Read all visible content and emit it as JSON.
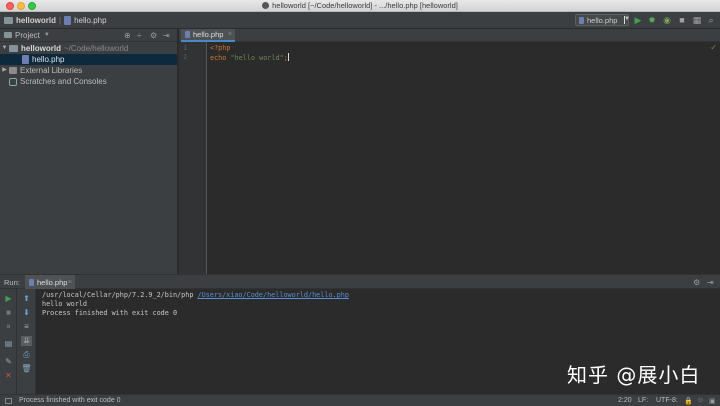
{
  "window": {
    "title": "helloworld [~/Code/helloworld] - .../hello.php [helloworld]"
  },
  "navbar": {
    "crumb_project": "helloworld",
    "crumb_file": "hello.php",
    "run_config": "hello.php"
  },
  "project": {
    "header_label": "Project",
    "tree": {
      "root_name": "helloworld",
      "root_path": "~/Code/helloworld",
      "file": "hello.php",
      "external_libraries": "External Libraries",
      "scratches": "Scratches and Consoles"
    }
  },
  "editor": {
    "tab_label": "hello.php",
    "line_numbers": [
      "1",
      "2"
    ],
    "code": {
      "open_tag": "<?php",
      "echo_kw": "echo",
      "string": "\"hello world\"",
      "semicolon": ";"
    }
  },
  "run_panel": {
    "label": "Run:",
    "tab_label": "hello.php",
    "console": {
      "command": "/usr/local/Cellar/php/7.2.9_2/bin/php",
      "script_link": "/Users/xiao/Code/helloworld/hello.php",
      "output": "hello world",
      "exit_msg": "Process finished with exit code 0"
    },
    "watermark": "知乎 @展小白"
  },
  "status_bar": {
    "message": "Process finished with exit code 0",
    "position": "2:20",
    "line_sep": "LF:",
    "encoding": "UTF-8:"
  },
  "colors": {
    "accent": "#4a88c7",
    "run_green": "#499c54",
    "keyword": "#cc7832",
    "string": "#6a8759",
    "link": "#5a8fd6"
  }
}
